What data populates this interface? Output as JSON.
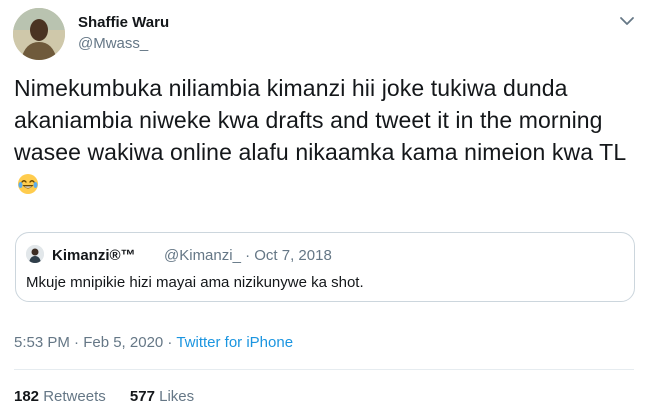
{
  "author": {
    "name": "Shaffie Waru",
    "handle": "@Mwass_"
  },
  "tweet": {
    "text": "Nimekumbuka niliambia kimanzi hii joke tukiwa dunda akaniambia niweke kwa drafts and tweet it in the morning wasee wakiwa online alafu nikaamka kama nimeion kwa TL",
    "emoji": "face-with-tears-of-joy"
  },
  "quoted_tweet": {
    "name": "Kimanzi®™",
    "handle_date": "@Kimanzi_ · Oct 7, 2018",
    "text": "Mkuje mnipikie hizi mayai ama nizikunywe ka shot."
  },
  "meta": {
    "time_date": "5:53 PM · Feb 5, 2020 · ",
    "source": "Twitter for iPhone"
  },
  "stats": {
    "retweets_count": "182",
    "retweets_label": "Retweets",
    "likes_count": "577",
    "likes_label": "Likes"
  },
  "colors": {
    "text": "#14171a",
    "secondary": "#657786",
    "link": "#1b95e0",
    "border": "#ccd6dd"
  }
}
